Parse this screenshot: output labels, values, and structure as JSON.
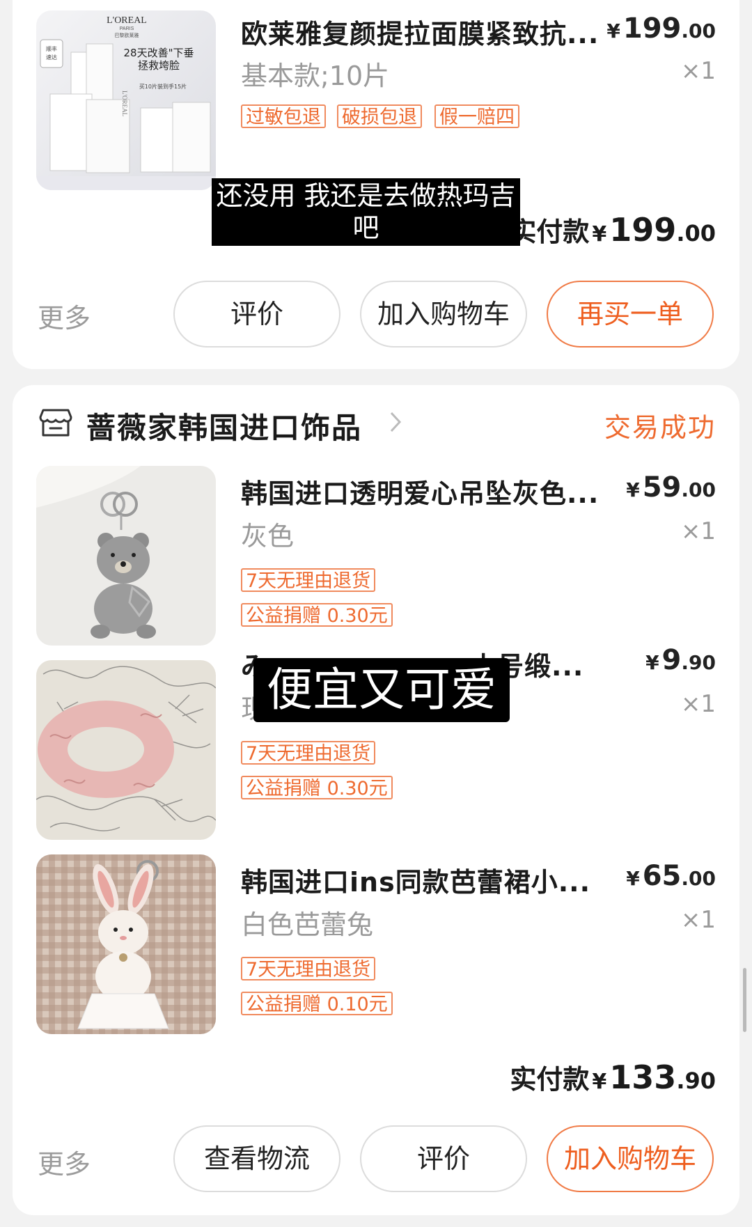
{
  "orders": [
    {
      "items": [
        {
          "title": "欧莱雅复颜提拉面膜紧致抗...",
          "variant": "基本款;10片",
          "price_yen": "¥",
          "price_int": "199",
          "price_dec": ".00",
          "qty": "×1",
          "tags": [
            "过敏包退",
            "破损包退",
            "假一赔四"
          ],
          "thumb_text": {
            "brand": "L'OREAL",
            "paris": "PARIS",
            "cn": "巴黎欧莱雅",
            "badge1": "顺丰",
            "badge2": "速达",
            "line1": "28天改善\"下垂",
            "line2": "拯救垮脸",
            "line3": "买10片装到手15片",
            "side": "L'OREAL"
          }
        }
      ],
      "total_label": "实付款",
      "total_yen": "¥",
      "total_int": "199",
      "total_dec": ".00",
      "more": "更多",
      "buttons": [
        "评价",
        "加入购物车",
        "再买一单"
      ]
    },
    {
      "shop_name": "蔷薇家韩国进口饰品",
      "status": "交易成功",
      "items": [
        {
          "title": "韩国进口透明爱心吊坠灰色...",
          "variant": "灰色",
          "price_yen": "¥",
          "price_int": "59",
          "price_dec": ".00",
          "qty": "×1",
          "tags": [
            "7天无理由退货",
            "公益捐赠 0.30元"
          ]
        },
        {
          "title": "小号缎...",
          "title_prefix": "み",
          "variant": "现货",
          "price_yen": "¥",
          "price_int": "9",
          "price_dec": ".90",
          "qty": "×1",
          "tags": [
            "7天无理由退货",
            "公益捐赠 0.30元"
          ]
        },
        {
          "title": "韩国进口ins同款芭蕾裙小...",
          "variant": "白色芭蕾兔",
          "price_yen": "¥",
          "price_int": "65",
          "price_dec": ".00",
          "qty": "×1",
          "tags": [
            "7天无理由退货",
            "公益捐赠 0.10元"
          ]
        }
      ],
      "total_label": "实付款",
      "total_yen": "¥",
      "total_int": "133",
      "total_dec": ".90",
      "more": "更多",
      "buttons": [
        "查看物流",
        "评价",
        "加入购物车"
      ]
    }
  ],
  "captions": {
    "first_line1": "还没用 我还是去做热玛吉",
    "first_line2": "吧",
    "second": "便宜又可爱"
  },
  "colors": {
    "accent": "#ee6a2f",
    "background": "#f2f2f2",
    "card": "#ffffff"
  }
}
